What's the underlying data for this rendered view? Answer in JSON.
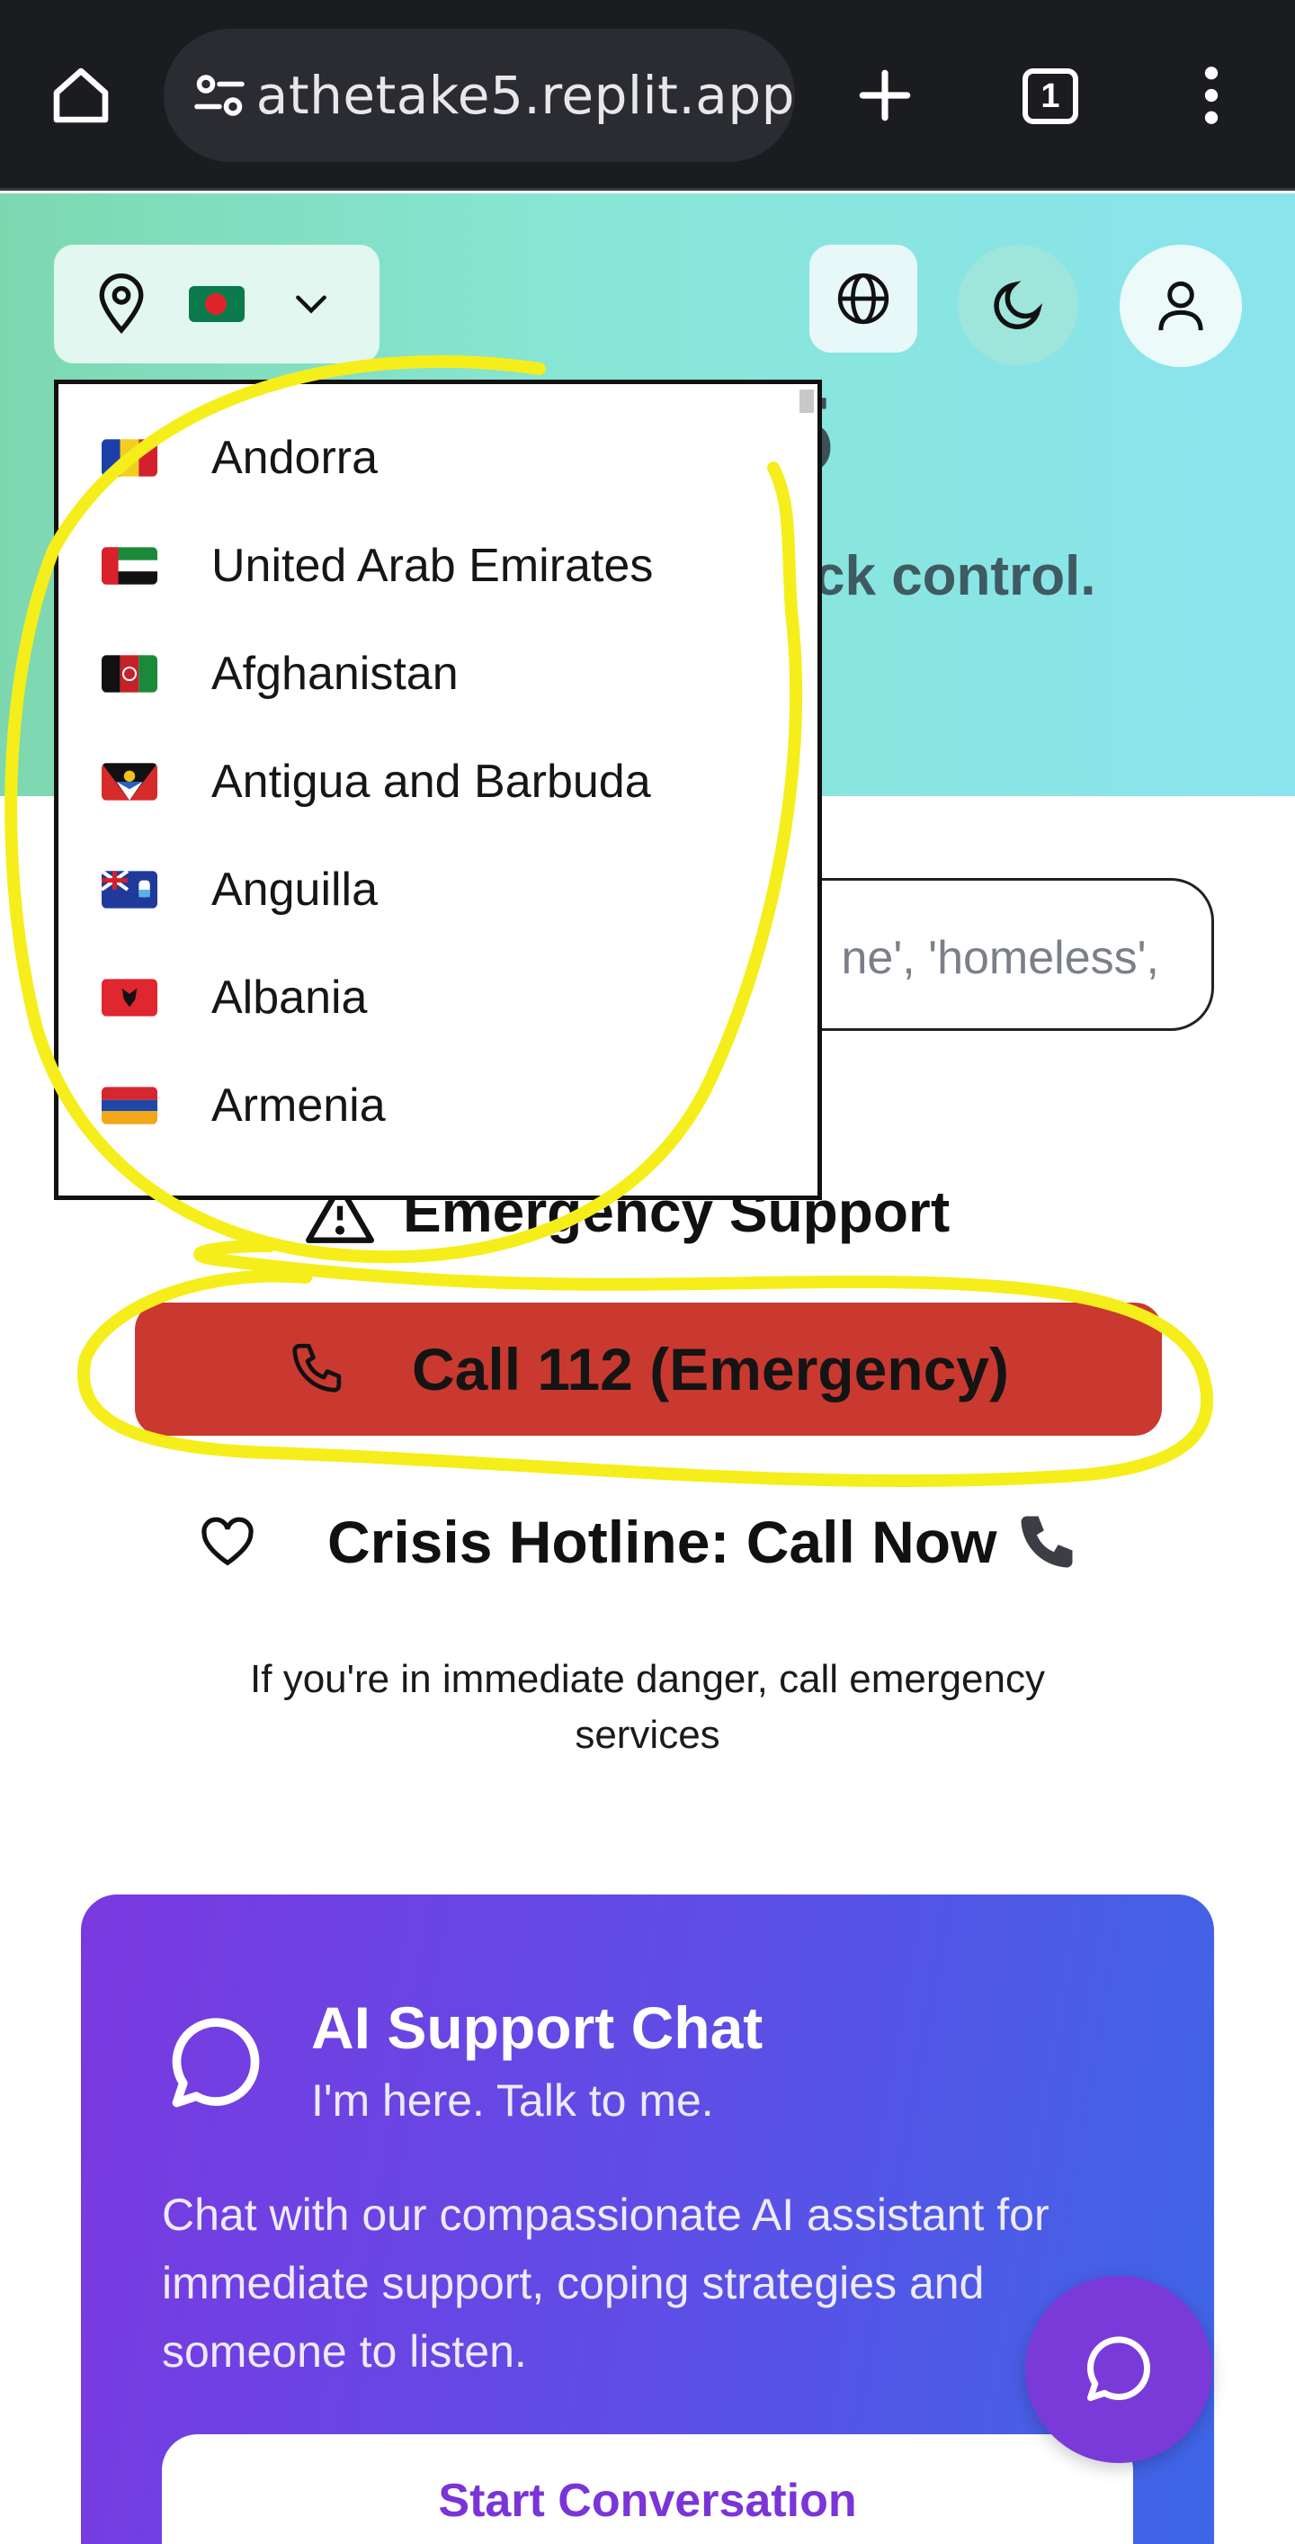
{
  "browser": {
    "url": "athetake5.replit.app",
    "tab_count": "1",
    "icons": [
      "home-icon",
      "site-settings-icon",
      "new-tab-icon",
      "tab-switcher-icon",
      "more-menu-icon"
    ]
  },
  "header": {
    "title_fragment": "5",
    "subtitle_fragment": "ck control.",
    "location_icon": "map-pin-icon",
    "selected_country_flag": "bangladesh-flag",
    "icons": [
      "globe-icon",
      "moon-icon",
      "user-icon"
    ]
  },
  "search": {
    "hint": "ne', 'homeless',"
  },
  "country_dropdown": {
    "items": [
      {
        "name": "Andorra",
        "flag": "andorra-flag"
      },
      {
        "name": "United Arab Emirates",
        "flag": "uae-flag"
      },
      {
        "name": "Afghanistan",
        "flag": "afghanistan-flag"
      },
      {
        "name": "Antigua and Barbuda",
        "flag": "antigua-flag"
      },
      {
        "name": "Anguilla",
        "flag": "anguilla-flag"
      },
      {
        "name": "Albania",
        "flag": "albania-flag"
      },
      {
        "name": "Armenia",
        "flag": "armenia-flag"
      }
    ]
  },
  "emergency": {
    "title": "Emergency Support",
    "call_label": "Call 112 (Emergency)",
    "crisis_label": "Crisis Hotline: Call Now",
    "danger_text": "If you're in immediate danger, call emergency services",
    "call_button_color": "#c9392f"
  },
  "ai_chat": {
    "title": "AI Support Chat",
    "subtitle": "I'm here. Talk to me.",
    "description": "Chat with our compassionate AI assistant for immediate support, coping strategies and someone to listen.",
    "button_label": "Start Conversation",
    "accent": "#7a3ad9"
  },
  "annotation_color": "#f5ee1a"
}
